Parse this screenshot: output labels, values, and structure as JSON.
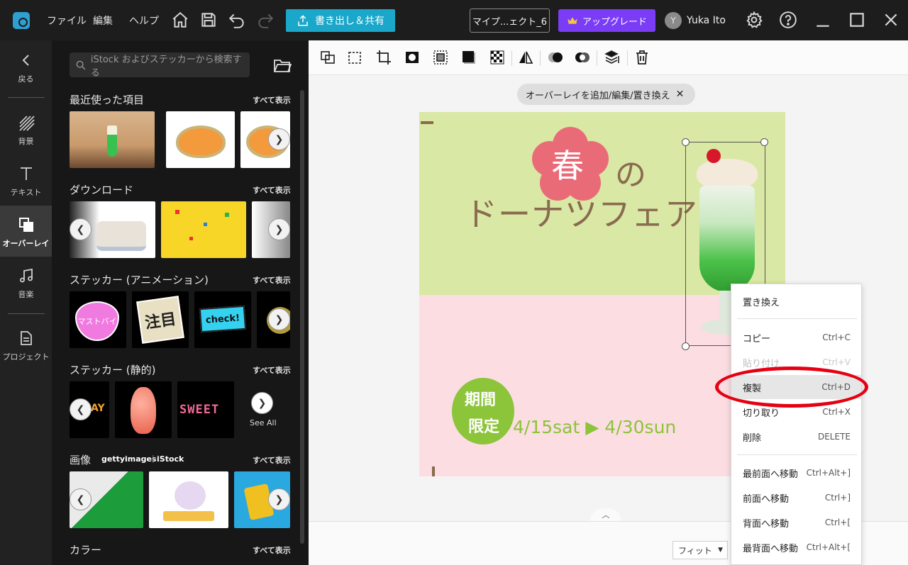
{
  "titlebar": {
    "menu": [
      "ファイル",
      "編集",
      "ヘルプ"
    ],
    "export_label": "書き出し＆共有",
    "project_name": "マイプ...ェクト_6",
    "upgrade_label": "アップグレード",
    "avatar_initial": "Y",
    "user_name": "Yuka Ito"
  },
  "rail": {
    "back": "戻る",
    "items": [
      "背景",
      "テキスト",
      "オーバーレイ",
      "音楽",
      "プロジェクト"
    ],
    "active": "オーバーレイ"
  },
  "panel": {
    "search_placeholder": "iStock およびステッカーから検索する",
    "see_all": "すべて表示",
    "see_all_en": "See All",
    "sections": [
      "最近使った項目",
      "ダウンロード",
      "ステッカー (アニメーション)",
      "ステッカー (静的)",
      "画像",
      "カラー"
    ],
    "image_brands": [
      "gettyimages",
      "iStock"
    ],
    "sticker_texts": {
      "heart": "マストバイ",
      "chu": "注目",
      "check": "check!",
      "sweet": "SWEET",
      "day": "AY"
    }
  },
  "editor": {
    "overlay_chip": "オーバーレイを追加/編集/置き換え",
    "fit_label": "フィット"
  },
  "canvas": {
    "kanji": "春",
    "no": "の",
    "headline": "ドーナツフェア",
    "badge_line1": "期間",
    "badge_line2": "限定",
    "dates": "4/15sat ▶ 4/30sun"
  },
  "context_menu": {
    "items": [
      {
        "label": "置き換え",
        "shortcut": "",
        "disabled": false
      },
      {
        "label": "コピー",
        "shortcut": "Ctrl+C",
        "disabled": false
      },
      {
        "label": "貼り付け",
        "shortcut": "Ctrl+V",
        "disabled": true
      },
      {
        "label": "複製",
        "shortcut": "Ctrl+D",
        "disabled": false
      },
      {
        "label": "切り取り",
        "shortcut": "Ctrl+X",
        "disabled": false
      },
      {
        "label": "削除",
        "shortcut": "DELETE",
        "disabled": false
      },
      {
        "label": "最前面へ移動",
        "shortcut": "Ctrl+Alt+]",
        "disabled": false
      },
      {
        "label": "前面へ移動",
        "shortcut": "Ctrl+]",
        "disabled": false
      },
      {
        "label": "背面へ移動",
        "shortcut": "Ctrl+[",
        "disabled": false
      },
      {
        "label": "最背面へ移動",
        "shortcut": "Ctrl+Alt+[",
        "disabled": false
      }
    ],
    "highlighted": "複製"
  },
  "colors": {
    "accent_cyan": "#1aa7c9",
    "upgrade_purple": "#7a3cf5",
    "canvas_green": "#d9e8a4",
    "canvas_pink": "#fbdde2",
    "annotation_red": "#e60012"
  }
}
